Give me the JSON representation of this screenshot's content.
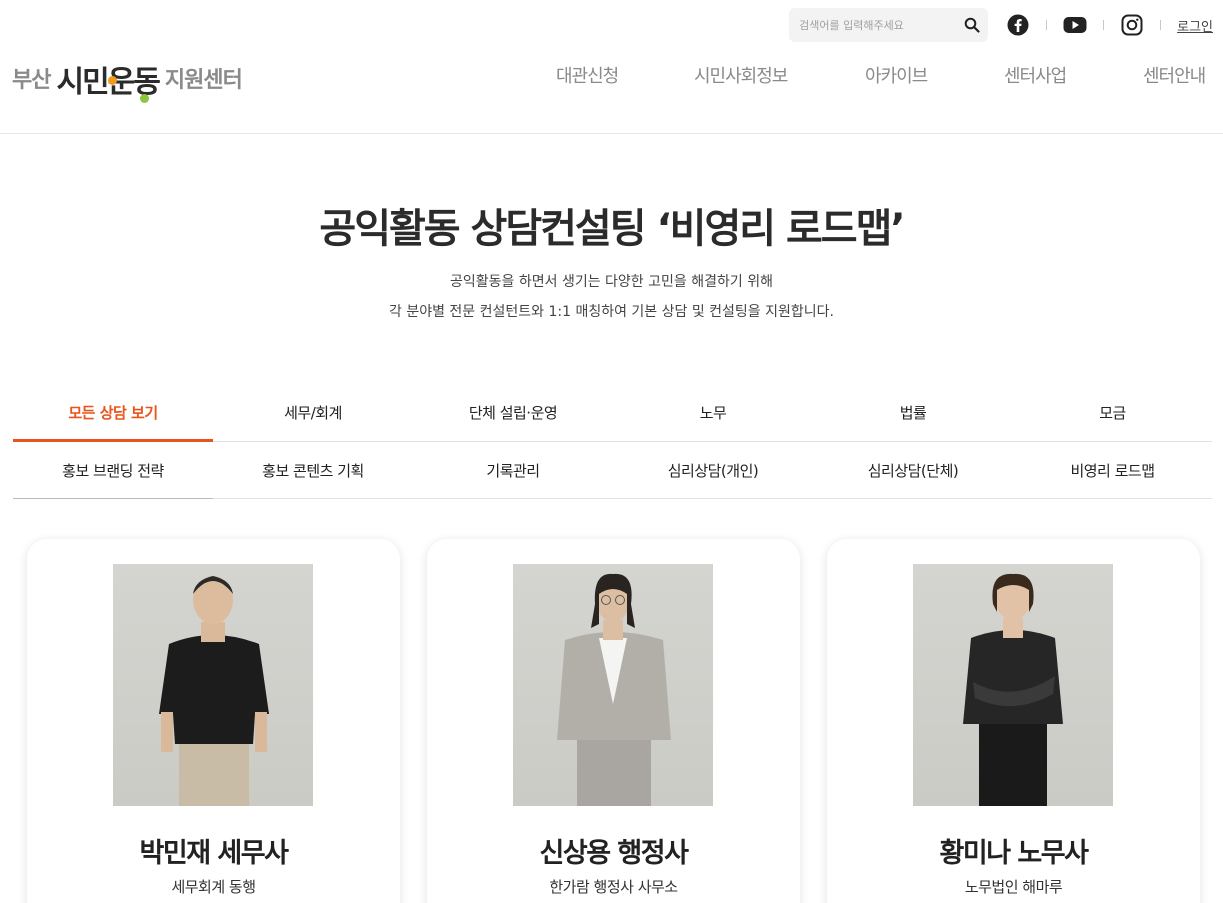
{
  "header": {
    "logo": {
      "left": "부산",
      "middle": "시민운동",
      "right": "지원센터"
    },
    "search": {
      "placeholder": "검색어를 입력해주세요"
    },
    "sns": [
      "facebook-icon",
      "youtube-icon",
      "instagram-icon"
    ],
    "login_label": "로그인",
    "nav": [
      "대관신청",
      "시민사회정보",
      "아카이브",
      "센터사업",
      "센터안내"
    ]
  },
  "intro": {
    "title": "공익활동 상담컨설팅 ‘비영리 로드맵’",
    "desc_line1": "공익활동을 하면서 생기는 다양한 고민을 해결하기 위해",
    "desc_line2": "각 분야별 전문 컨설턴트와 1:1 매칭하여 기본 상담 및 컨설팅을 지원합니다."
  },
  "tabs": {
    "row1": [
      "모든 상담 보기",
      "세무/회계",
      "단체 설립·운영",
      "노무",
      "법률",
      "모금"
    ],
    "row2": [
      "홍보 브랜딩 전략",
      "홍보 콘텐츠 기획",
      "기록관리",
      "심리상담(개인)",
      "심리상담(단체)",
      "비영리 로드맵"
    ],
    "active": "모든 상담 보기"
  },
  "consultants": [
    {
      "name": "박민재 세무사",
      "org": "세무회계 동행"
    },
    {
      "name": "신상용 행정사",
      "org": "한가람 행정사 사무소"
    },
    {
      "name": "황미나 노무사",
      "org": "노무법인 해마루"
    }
  ],
  "colors": {
    "accent": "#e8541c",
    "logo_orange": "#f39a1e",
    "logo_green": "#8cc63f"
  }
}
